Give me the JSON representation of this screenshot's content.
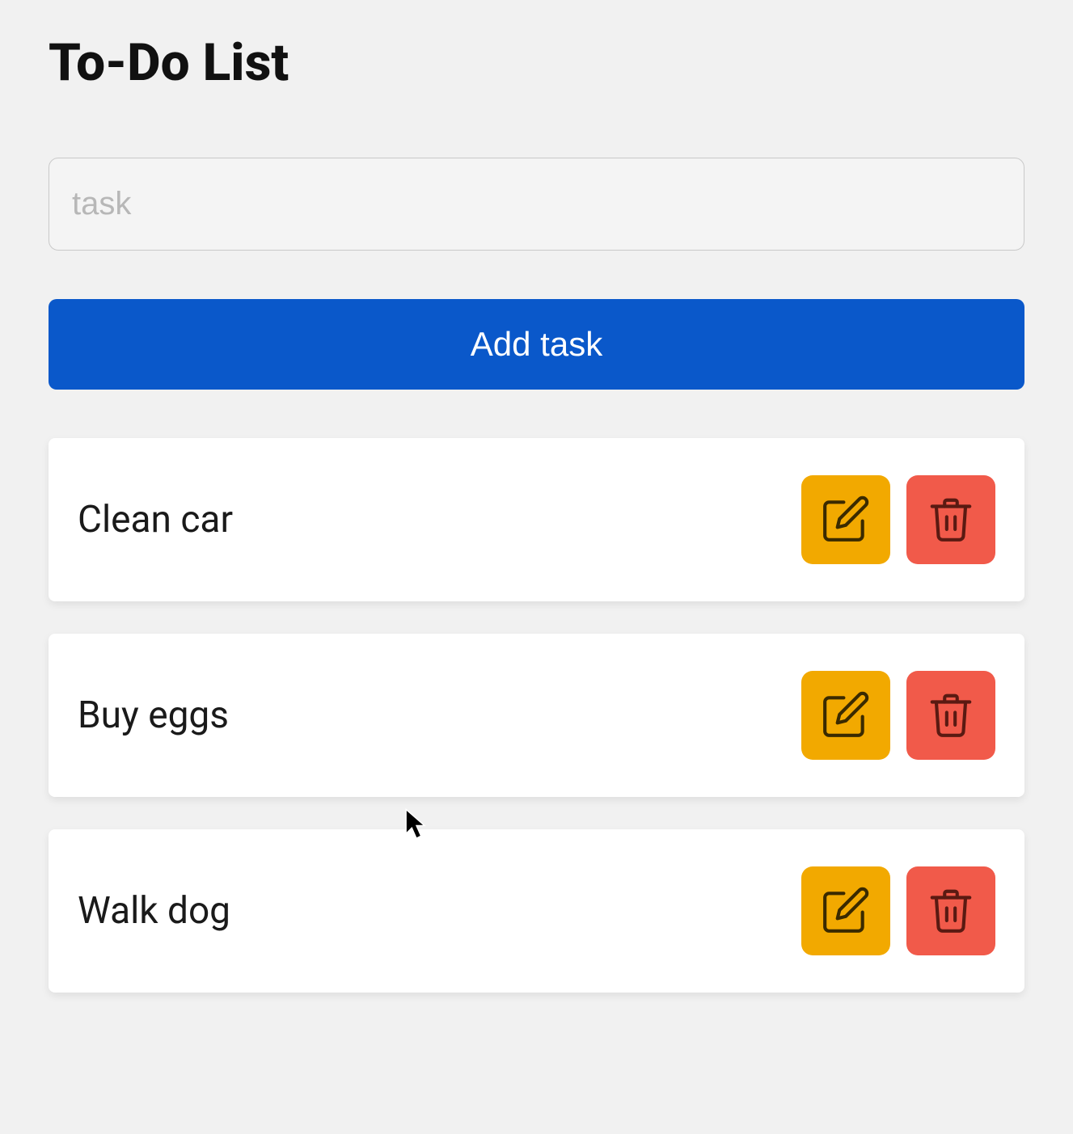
{
  "header": {
    "title": "To-Do List"
  },
  "input": {
    "placeholder": "task",
    "value": ""
  },
  "buttons": {
    "add_label": "Add task"
  },
  "tasks": [
    {
      "label": "Clean car"
    },
    {
      "label": "Buy eggs"
    },
    {
      "label": "Walk dog"
    }
  ],
  "icons": {
    "edit": "edit-icon",
    "delete": "trash-icon"
  },
  "colors": {
    "primary": "#0a58ca",
    "edit_bg": "#f2a900",
    "delete_bg": "#f15a4a",
    "page_bg": "#f1f1f1",
    "card_bg": "#ffffff"
  }
}
